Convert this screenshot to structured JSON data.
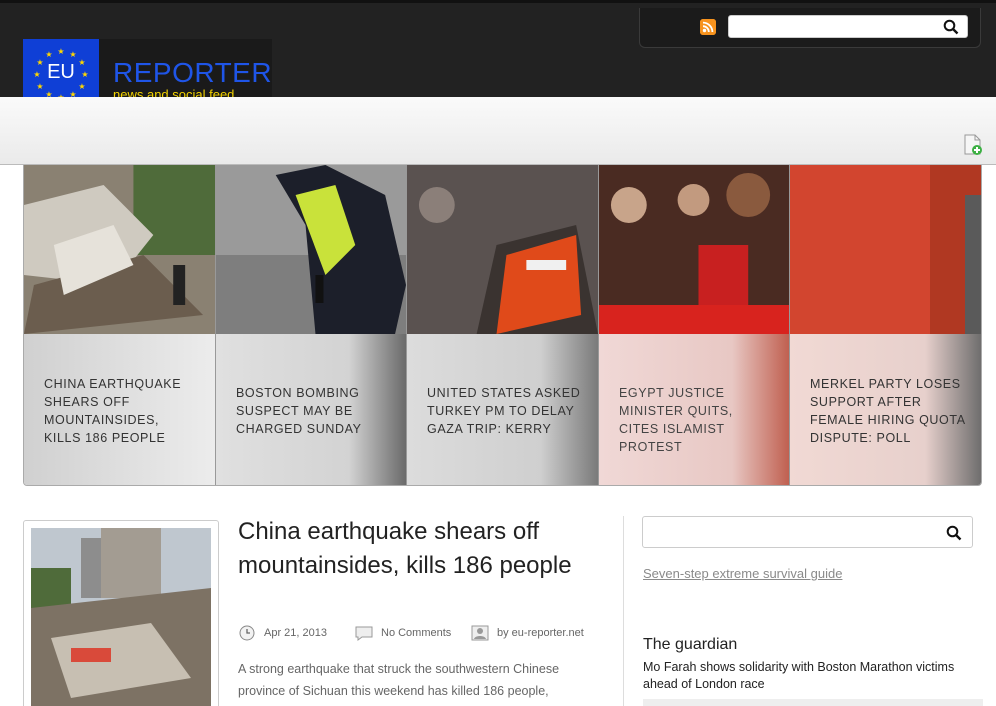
{
  "header": {
    "rss_icon": "rss-icon",
    "search_icon": "search-icon",
    "logo": {
      "flag_text": "EU",
      "title": "REPORTER",
      "subtitle": "news and social feed"
    }
  },
  "slider": {
    "slides": [
      {
        "caption": "CHINA EARTHQUAKE SHEARS OFF MOUNTAINSIDES, KILLS 186 PEOPLE"
      },
      {
        "caption": "BOSTON BOMBING SUSPECT MAY BE CHARGED SUNDAY"
      },
      {
        "caption": "UNITED STATES ASKED TURKEY PM TO DELAY GAZA TRIP: KERRY"
      },
      {
        "caption": "EGYPT JUSTICE MINISTER QUITS, CITES ISLAMIST PROTEST"
      },
      {
        "caption": "MERKEL PARTY LOSES SUPPORT AFTER FEMALE HIRING QUOTA DISPUTE: POLL"
      }
    ]
  },
  "article": {
    "title": "China earthquake shears off mountainsides, kills 186 people",
    "date": "Apr 21, 2013",
    "comments": "No Comments",
    "author": "by eu-reporter.net",
    "excerpt": "A strong earthquake that struck the southwestern Chinese province of Sichuan this weekend has killed 186 people,"
  },
  "sidebar": {
    "link": "Seven-step extreme survival guide",
    "guardian": {
      "title": "The guardian",
      "item": "Mo Farah shows solidarity with Boston Marathon victims ahead of London race"
    }
  },
  "colors": {
    "brand_blue": "#1f55e8",
    "brand_yellow": "#f2d200",
    "header_bg": "#222222"
  }
}
